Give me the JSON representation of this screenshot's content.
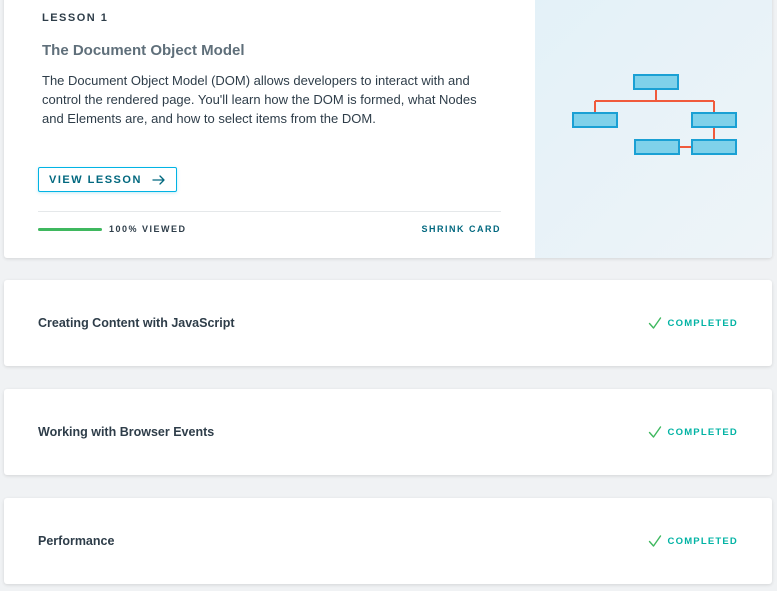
{
  "featured": {
    "kicker": "LESSON 1",
    "title": "The Document Object Model",
    "summary": "The Document Object Model (DOM) allows developers to interact with and control the rendered page. You'll learn how the DOM is formed, what Nodes and Elements are, and how to select items from the DOM.",
    "button_label": "VIEW LESSON",
    "progress_label": "100% VIEWED",
    "progress_fraction": 1.0,
    "shrink_label": "SHRINK CARD"
  },
  "lessons": [
    {
      "title": "Creating Content with JavaScript",
      "status": "COMPLETED"
    },
    {
      "title": "Working with Browser Events",
      "status": "COMPLETED"
    },
    {
      "title": "Performance",
      "status": "COMPLETED"
    }
  ],
  "colors": {
    "accent": "#02b3e4",
    "accent_dark": "#02687f",
    "progress": "#3fb85f",
    "completed": "#02b3a4",
    "diagram_lines": "#f05a3c",
    "diagram_boxes": "#7fd1ea"
  }
}
